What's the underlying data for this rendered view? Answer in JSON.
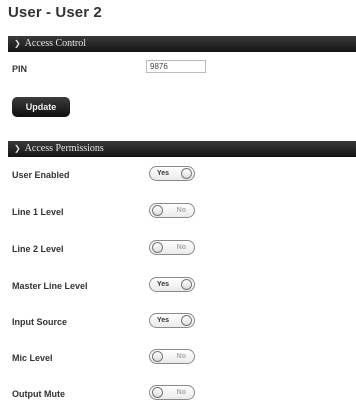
{
  "page_title": "User - User 2",
  "access_control": {
    "header": "Access Control",
    "pin_label": "PIN",
    "pin_value": "9876",
    "update_label": "Update"
  },
  "access_permissions": {
    "header": "Access Permissions",
    "rows": [
      {
        "label": "User Enabled",
        "on": true,
        "text": "Yes"
      },
      {
        "label": "Line 1 Level",
        "on": false,
        "text": "No"
      },
      {
        "label": "Line 2 Level",
        "on": false,
        "text": "No"
      },
      {
        "label": "Master Line Level",
        "on": true,
        "text": "Yes"
      },
      {
        "label": "Input Source",
        "on": true,
        "text": "Yes"
      },
      {
        "label": "Mic Level",
        "on": false,
        "text": "No"
      },
      {
        "label": "Output Mute",
        "on": false,
        "text": "No"
      }
    ]
  }
}
